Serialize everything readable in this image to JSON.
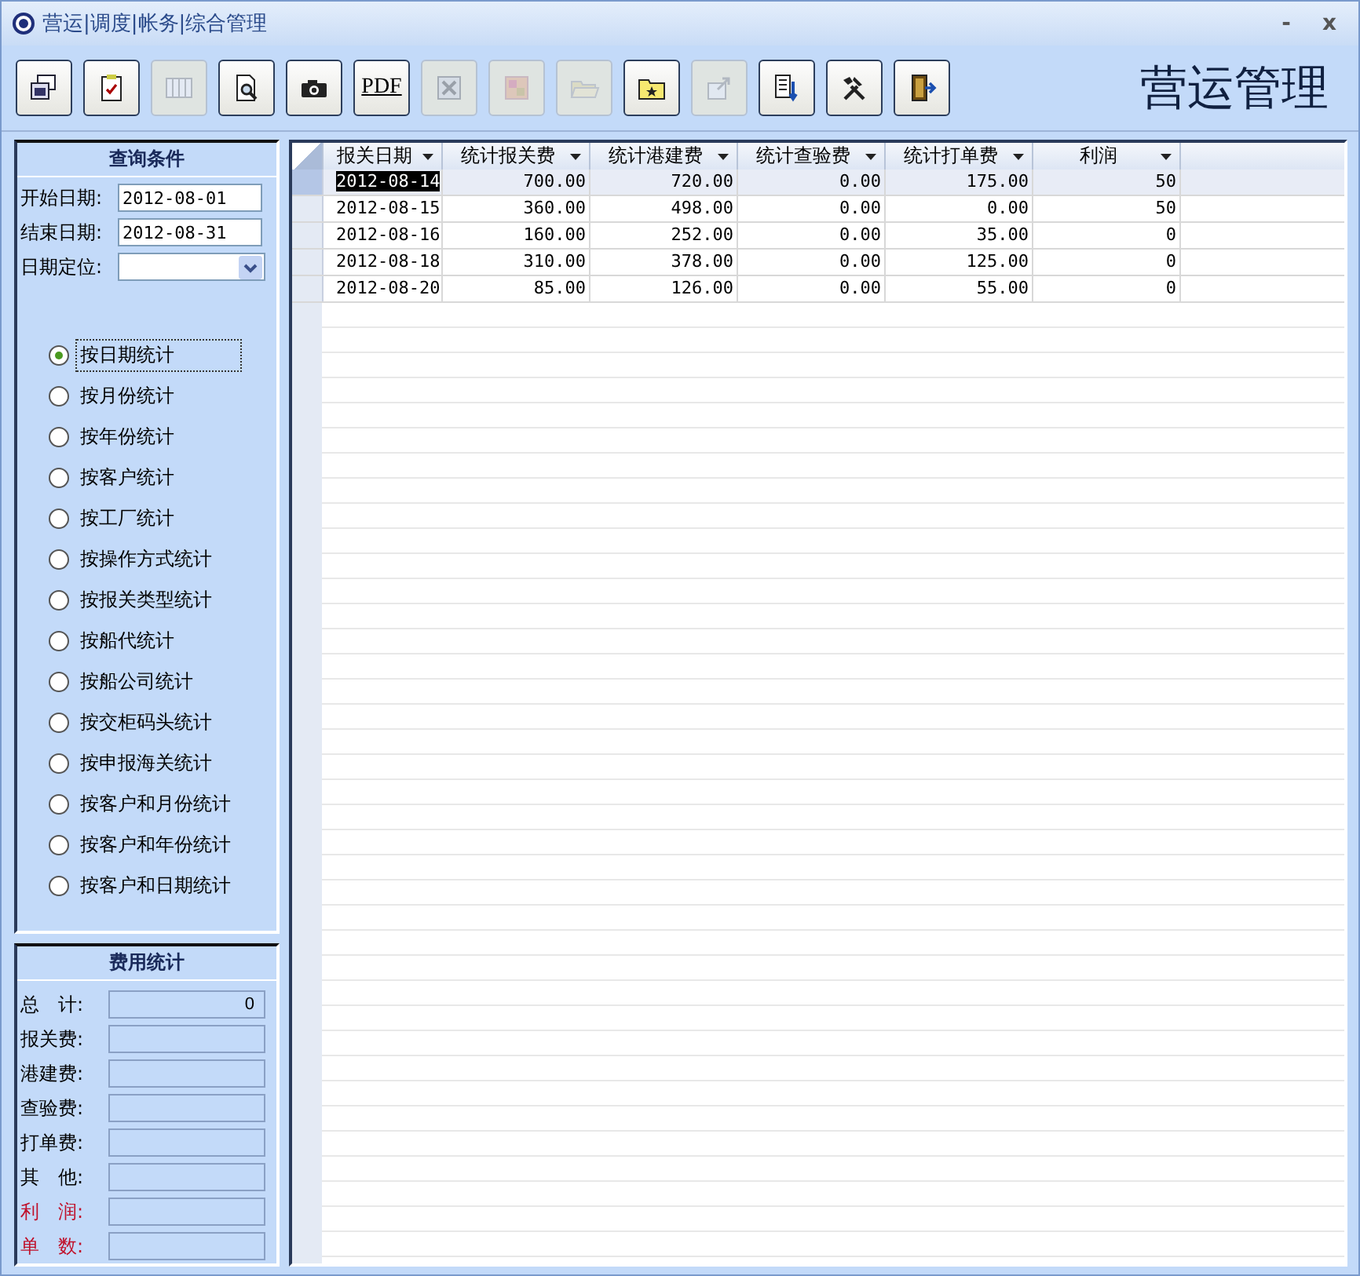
{
  "window": {
    "title": "营运|调度|帐务|综合管理",
    "controls": [
      "-",
      "x"
    ]
  },
  "toolbar": {
    "buttons": [
      {
        "disabled": false
      },
      {
        "disabled": false
      },
      {
        "disabled": true
      },
      {
        "disabled": false
      },
      {
        "disabled": false
      },
      {
        "disabled": false,
        "label": "PDF"
      },
      {
        "disabled": true
      },
      {
        "disabled": true
      },
      {
        "disabled": true
      },
      {
        "disabled": false
      },
      {
        "disabled": true
      },
      {
        "disabled": false
      },
      {
        "disabled": false
      },
      {
        "disabled": false
      }
    ],
    "brand": "营运管理"
  },
  "query_panel": {
    "title": "查询条件",
    "fields": [
      {
        "label": "开始日期:",
        "value": "2012-08-01",
        "kind": "text"
      },
      {
        "label": "结束日期:",
        "value": "2012-08-31",
        "kind": "text"
      },
      {
        "label": "日期定位:",
        "kind": "dropdown"
      }
    ],
    "options": [
      {
        "label": "按日期统计",
        "selected": true
      },
      {
        "label": "按月份统计",
        "selected": false
      },
      {
        "label": "按年份统计",
        "selected": false
      },
      {
        "label": "按客户统计",
        "selected": false
      },
      {
        "label": "按工厂统计",
        "selected": false
      },
      {
        "label": "按操作方式统计",
        "selected": false
      },
      {
        "label": "按报关类型统计",
        "selected": false
      },
      {
        "label": "按船代统计",
        "selected": false
      },
      {
        "label": "按船公司统计",
        "selected": false
      },
      {
        "label": "按交柜码头统计",
        "selected": false
      },
      {
        "label": "按申报海关统计",
        "selected": false
      },
      {
        "label": "按客户和月份统计",
        "selected": false
      },
      {
        "label": "按客户和年份统计",
        "selected": false
      },
      {
        "label": "按客户和日期统计",
        "selected": false
      }
    ]
  },
  "fee_panel": {
    "title": "费用统计",
    "fields": [
      {
        "label": "总　计:",
        "value": "0",
        "highlight": false
      },
      {
        "label": "报关费:",
        "highlight": false
      },
      {
        "label": "港建费:",
        "highlight": false
      },
      {
        "label": "查验费:",
        "highlight": false
      },
      {
        "label": "打单费:",
        "highlight": false
      },
      {
        "label": "其　他:",
        "highlight": false
      },
      {
        "label": "利　润:",
        "highlight": true
      },
      {
        "label": "单　数:",
        "highlight": true
      }
    ]
  },
  "table": {
    "columns": [
      "报关日期",
      "统计报关费",
      "统计港建费",
      "统计查验费",
      "统计打单费",
      "利润"
    ],
    "rows": [
      {
        "selected": true,
        "cells": [
          "2012-08-14",
          "700.00",
          "720.00",
          "0.00",
          "175.00",
          "50"
        ]
      },
      {
        "selected": false,
        "cells": [
          "2012-08-15",
          "360.00",
          "498.00",
          "0.00",
          "0.00",
          "50"
        ]
      },
      {
        "selected": false,
        "cells": [
          "2012-08-16",
          "160.00",
          "252.00",
          "0.00",
          "35.00",
          "0"
        ]
      },
      {
        "selected": false,
        "cells": [
          "2012-08-18",
          "310.00",
          "378.00",
          "0.00",
          "125.00",
          "0"
        ]
      },
      {
        "selected": false,
        "cells": [
          "2012-08-20",
          "85.00",
          "126.00",
          "0.00",
          "55.00",
          "0"
        ]
      }
    ]
  }
}
